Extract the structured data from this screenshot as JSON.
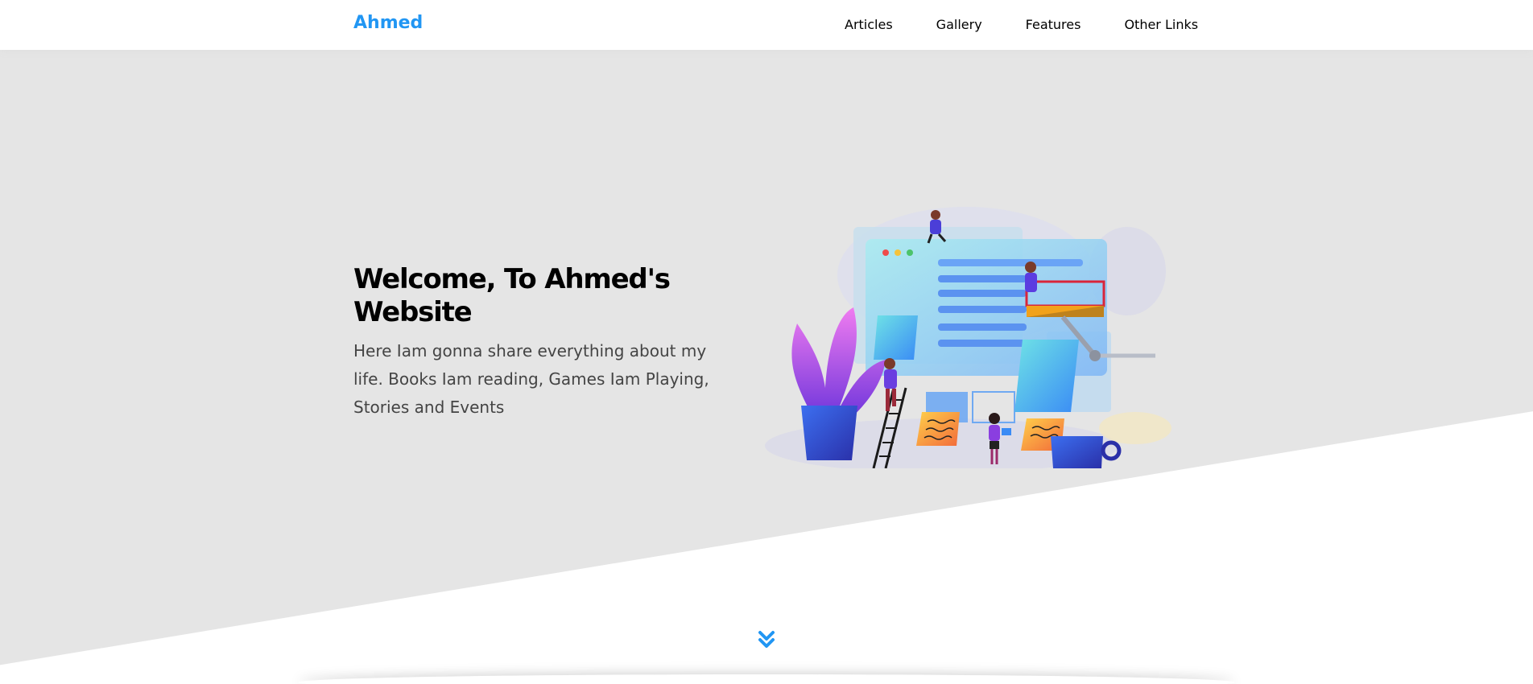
{
  "header": {
    "logo_text": "Ahmed",
    "nav": [
      {
        "label": "Articles"
      },
      {
        "label": "Gallery"
      },
      {
        "label": "Features"
      },
      {
        "label": "Other Links"
      }
    ]
  },
  "landing": {
    "title": "Welcome, To Ahmed's Website",
    "intro": "Here Iam gonna share everything about my life. Books Iam reading, Games Iam Playing, Stories and Events",
    "illustration_icon": "web-design-team-illustration",
    "scroll_icon": "double-chevron-down-icon"
  },
  "colors": {
    "accent": "#2196f3",
    "landing_bg": "#e5e5e5",
    "text_dark": "#000000",
    "text_muted": "#444444"
  }
}
